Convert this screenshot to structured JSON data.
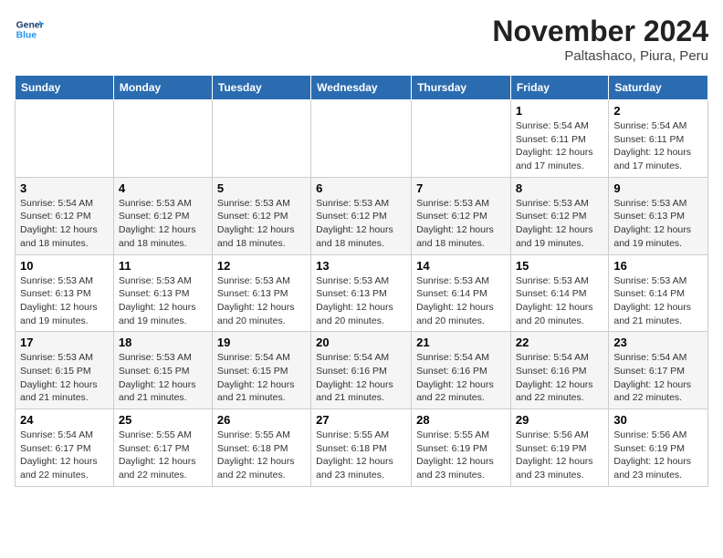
{
  "header": {
    "logo_line1": "General",
    "logo_line2": "Blue",
    "month": "November 2024",
    "location": "Paltashaco, Piura, Peru"
  },
  "weekdays": [
    "Sunday",
    "Monday",
    "Tuesday",
    "Wednesday",
    "Thursday",
    "Friday",
    "Saturday"
  ],
  "weeks": [
    [
      {
        "day": "",
        "info": ""
      },
      {
        "day": "",
        "info": ""
      },
      {
        "day": "",
        "info": ""
      },
      {
        "day": "",
        "info": ""
      },
      {
        "day": "",
        "info": ""
      },
      {
        "day": "1",
        "info": "Sunrise: 5:54 AM\nSunset: 6:11 PM\nDaylight: 12 hours and 17 minutes."
      },
      {
        "day": "2",
        "info": "Sunrise: 5:54 AM\nSunset: 6:11 PM\nDaylight: 12 hours and 17 minutes."
      }
    ],
    [
      {
        "day": "3",
        "info": "Sunrise: 5:54 AM\nSunset: 6:12 PM\nDaylight: 12 hours and 18 minutes."
      },
      {
        "day": "4",
        "info": "Sunrise: 5:53 AM\nSunset: 6:12 PM\nDaylight: 12 hours and 18 minutes."
      },
      {
        "day": "5",
        "info": "Sunrise: 5:53 AM\nSunset: 6:12 PM\nDaylight: 12 hours and 18 minutes."
      },
      {
        "day": "6",
        "info": "Sunrise: 5:53 AM\nSunset: 6:12 PM\nDaylight: 12 hours and 18 minutes."
      },
      {
        "day": "7",
        "info": "Sunrise: 5:53 AM\nSunset: 6:12 PM\nDaylight: 12 hours and 18 minutes."
      },
      {
        "day": "8",
        "info": "Sunrise: 5:53 AM\nSunset: 6:12 PM\nDaylight: 12 hours and 19 minutes."
      },
      {
        "day": "9",
        "info": "Sunrise: 5:53 AM\nSunset: 6:13 PM\nDaylight: 12 hours and 19 minutes."
      }
    ],
    [
      {
        "day": "10",
        "info": "Sunrise: 5:53 AM\nSunset: 6:13 PM\nDaylight: 12 hours and 19 minutes."
      },
      {
        "day": "11",
        "info": "Sunrise: 5:53 AM\nSunset: 6:13 PM\nDaylight: 12 hours and 19 minutes."
      },
      {
        "day": "12",
        "info": "Sunrise: 5:53 AM\nSunset: 6:13 PM\nDaylight: 12 hours and 20 minutes."
      },
      {
        "day": "13",
        "info": "Sunrise: 5:53 AM\nSunset: 6:13 PM\nDaylight: 12 hours and 20 minutes."
      },
      {
        "day": "14",
        "info": "Sunrise: 5:53 AM\nSunset: 6:14 PM\nDaylight: 12 hours and 20 minutes."
      },
      {
        "day": "15",
        "info": "Sunrise: 5:53 AM\nSunset: 6:14 PM\nDaylight: 12 hours and 20 minutes."
      },
      {
        "day": "16",
        "info": "Sunrise: 5:53 AM\nSunset: 6:14 PM\nDaylight: 12 hours and 21 minutes."
      }
    ],
    [
      {
        "day": "17",
        "info": "Sunrise: 5:53 AM\nSunset: 6:15 PM\nDaylight: 12 hours and 21 minutes."
      },
      {
        "day": "18",
        "info": "Sunrise: 5:53 AM\nSunset: 6:15 PM\nDaylight: 12 hours and 21 minutes."
      },
      {
        "day": "19",
        "info": "Sunrise: 5:54 AM\nSunset: 6:15 PM\nDaylight: 12 hours and 21 minutes."
      },
      {
        "day": "20",
        "info": "Sunrise: 5:54 AM\nSunset: 6:16 PM\nDaylight: 12 hours and 21 minutes."
      },
      {
        "day": "21",
        "info": "Sunrise: 5:54 AM\nSunset: 6:16 PM\nDaylight: 12 hours and 22 minutes."
      },
      {
        "day": "22",
        "info": "Sunrise: 5:54 AM\nSunset: 6:16 PM\nDaylight: 12 hours and 22 minutes."
      },
      {
        "day": "23",
        "info": "Sunrise: 5:54 AM\nSunset: 6:17 PM\nDaylight: 12 hours and 22 minutes."
      }
    ],
    [
      {
        "day": "24",
        "info": "Sunrise: 5:54 AM\nSunset: 6:17 PM\nDaylight: 12 hours and 22 minutes."
      },
      {
        "day": "25",
        "info": "Sunrise: 5:55 AM\nSunset: 6:17 PM\nDaylight: 12 hours and 22 minutes."
      },
      {
        "day": "26",
        "info": "Sunrise: 5:55 AM\nSunset: 6:18 PM\nDaylight: 12 hours and 22 minutes."
      },
      {
        "day": "27",
        "info": "Sunrise: 5:55 AM\nSunset: 6:18 PM\nDaylight: 12 hours and 23 minutes."
      },
      {
        "day": "28",
        "info": "Sunrise: 5:55 AM\nSunset: 6:19 PM\nDaylight: 12 hours and 23 minutes."
      },
      {
        "day": "29",
        "info": "Sunrise: 5:56 AM\nSunset: 6:19 PM\nDaylight: 12 hours and 23 minutes."
      },
      {
        "day": "30",
        "info": "Sunrise: 5:56 AM\nSunset: 6:19 PM\nDaylight: 12 hours and 23 minutes."
      }
    ]
  ]
}
